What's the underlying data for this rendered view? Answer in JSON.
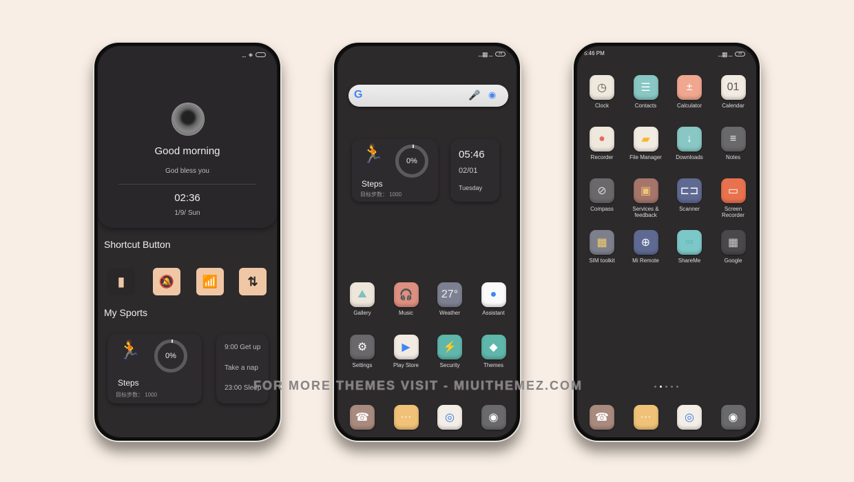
{
  "phone1": {
    "status": {
      "signal": "....",
      "location": "◈",
      "battery": ""
    },
    "profile": {
      "greeting": "Good morning",
      "subtitle": "God bless you",
      "time": "02:36",
      "date": "1/9/ Sun"
    },
    "shortcut_title": "Shortcut Button",
    "shortcuts": [
      {
        "name": "flashlight",
        "glyph": "▮",
        "active": false
      },
      {
        "name": "silent",
        "glyph": "🔕",
        "active": true
      },
      {
        "name": "wifi",
        "glyph": "📶",
        "active": true
      },
      {
        "name": "data",
        "glyph": "⇅",
        "active": true
      }
    ],
    "sports_title": "My Sports",
    "steps_widget": {
      "runner": "🏃",
      "progress": "0%",
      "label": "Steps",
      "goal": "目标步数： 1000"
    },
    "schedule": [
      "9:00 Get up",
      "Take a nap",
      "23:00 Sleep"
    ]
  },
  "phone2": {
    "status": {
      "signal": "....▦ ....",
      "battery": "39"
    },
    "search": {
      "g": "G",
      "mic": "🎤",
      "lens": "◉"
    },
    "steps_widget": {
      "runner": "🏃",
      "progress": "0%",
      "label": "Steps",
      "goal": "目标步数： 1000"
    },
    "clock_widget": {
      "time": "05:46",
      "date": "02/01",
      "day": "Tuesday"
    },
    "apps": [
      {
        "label": "Gallery",
        "glyph": "⛰",
        "bg": "#efe6da",
        "fg": "#7fc1bf"
      },
      {
        "label": "Music",
        "glyph": "🎧",
        "bg": "#de8f7f",
        "fg": "#fff"
      },
      {
        "label": "Weather",
        "glyph": "27°",
        "bg": "#7d8091",
        "fg": "#eee"
      },
      {
        "label": "Assistant",
        "glyph": "●",
        "bg": "#fafafa",
        "fg": "#4285f4"
      },
      {
        "label": "Settings",
        "glyph": "⚙",
        "bg": "#6a686a",
        "fg": "#fff"
      },
      {
        "label": "Play Store",
        "glyph": "▶",
        "bg": "#f1ebe2",
        "fg": "#4285f4"
      },
      {
        "label": "Security",
        "glyph": "⚡",
        "bg": "#5fb6ab",
        "fg": "#fff"
      },
      {
        "label": "Themes",
        "glyph": "◆",
        "bg": "#5fb6ab",
        "fg": "#fff"
      }
    ],
    "dock": [
      {
        "name": "phone",
        "glyph": "☎",
        "bg": "#a98a7e",
        "fg": "#fff"
      },
      {
        "name": "messages",
        "glyph": "···",
        "bg": "#f0c278",
        "fg": "#fff"
      },
      {
        "name": "chrome",
        "glyph": "◎",
        "bg": "#f3eee7",
        "fg": "#3a7be0"
      },
      {
        "name": "camera",
        "glyph": "◉",
        "bg": "#6a6a6c",
        "fg": "#fff"
      }
    ]
  },
  "phone3": {
    "status": {
      "time": "5:46 PM",
      "signal": "....▦ ....",
      "battery": "39"
    },
    "apps": [
      {
        "label": "Clock",
        "glyph": "◷",
        "bg": "#efe8dd",
        "fg": "#555"
      },
      {
        "label": "Contacts",
        "glyph": "☰",
        "bg": "#88c7c4",
        "fg": "#fff"
      },
      {
        "label": "Calculator",
        "glyph": "±",
        "bg": "#f0a78f",
        "fg": "#fff"
      },
      {
        "label": "Calendar",
        "glyph": "01",
        "bg": "#f2ebe2",
        "fg": "#555"
      },
      {
        "label": "Recorder",
        "glyph": "●",
        "bg": "#efe8dd",
        "fg": "#e56a5f"
      },
      {
        "label": "File Manager",
        "glyph": "▰",
        "bg": "#f2ebe2",
        "fg": "#f6b831"
      },
      {
        "label": "Downloads",
        "glyph": "↓",
        "bg": "#88c7c4",
        "fg": "#fff"
      },
      {
        "label": "Notes",
        "glyph": "≡",
        "bg": "#69686a",
        "fg": "#eee"
      },
      {
        "label": "Compass",
        "glyph": "⊘",
        "bg": "#6a686a",
        "fg": "#ddd"
      },
      {
        "label": "Services & feedback",
        "glyph": "▣",
        "bg": "#a6756a",
        "fg": "#f0c278"
      },
      {
        "label": "Scanner",
        "glyph": "⊏⊐",
        "bg": "#5f6a92",
        "fg": "#fff"
      },
      {
        "label": "Screen Recorder",
        "glyph": "▭",
        "bg": "#e8724e",
        "fg": "#fff"
      },
      {
        "label": "SIM toolkit",
        "glyph": "▦",
        "bg": "#7d808c",
        "fg": "#f5cc6a"
      },
      {
        "label": "Mi Remote",
        "glyph": "⊕",
        "bg": "#5f6a92",
        "fg": "#fff"
      },
      {
        "label": "ShareMe",
        "glyph": "∞",
        "bg": "#7cc7c7",
        "fg": "#5fb6b6"
      },
      {
        "label": "Google",
        "glyph": "▦",
        "bg": "#4a484a",
        "fg": "#ccc"
      }
    ],
    "page_dots": {
      "count": 5,
      "active": 1
    },
    "dock": [
      {
        "name": "phone",
        "glyph": "☎",
        "bg": "#a98a7e",
        "fg": "#fff"
      },
      {
        "name": "messages",
        "glyph": "···",
        "bg": "#f0c278",
        "fg": "#fff"
      },
      {
        "name": "chrome",
        "glyph": "◎",
        "bg": "#f3eee7",
        "fg": "#3a7be0"
      },
      {
        "name": "camera",
        "glyph": "◉",
        "bg": "#6a6a6c",
        "fg": "#fff"
      }
    ]
  },
  "watermark": "FOR MORE THEMES VISIT - MIUITHEMEZ.COM"
}
